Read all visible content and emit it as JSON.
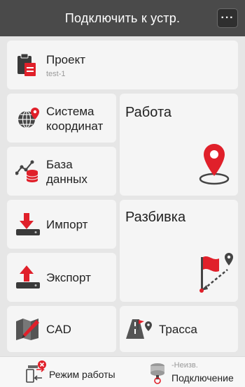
{
  "header": {
    "title": "Подключить к устр.",
    "more_label": "···"
  },
  "tiles": {
    "project": {
      "label": "Проект",
      "sub": "test-1"
    },
    "coordinate_system": {
      "label1": "Система",
      "label2": "координат"
    },
    "database": {
      "label1": "База",
      "label2": "данных"
    },
    "import": {
      "label": "Импорт"
    },
    "export": {
      "label": "Экспорт"
    },
    "cad": {
      "label": "CAD"
    },
    "work": {
      "label": "Работа"
    },
    "stakeout": {
      "label": "Разбивка"
    },
    "route": {
      "label": "Трасса"
    }
  },
  "footer": {
    "work_mode": {
      "label": "Режим работы"
    },
    "connection": {
      "status": "-Неизв.",
      "label": "Подключение"
    }
  },
  "colors": {
    "accent": "#e0202a",
    "header": "#4a4a4a",
    "tile": "#f5f5f5"
  }
}
